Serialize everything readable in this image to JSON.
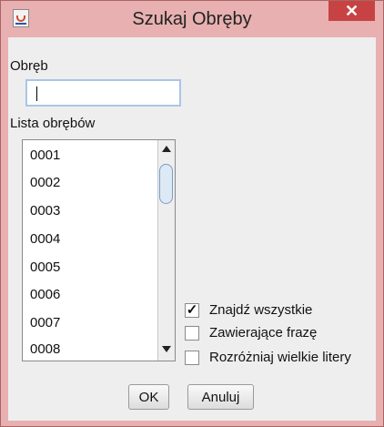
{
  "window": {
    "title": "Szukaj Obręby",
    "close_label": "✕"
  },
  "obreb": {
    "label": "Obręb",
    "value": ""
  },
  "list": {
    "label": "Lista obrębów",
    "items": [
      "0001",
      "0002",
      "0003",
      "0004",
      "0005",
      "0006",
      "0007",
      "0008"
    ]
  },
  "options": [
    {
      "label": "Znajdź wszystkie",
      "checked": true
    },
    {
      "label": "Zawierające frazę",
      "checked": false
    },
    {
      "label": "Rozróżniaj wielkie litery",
      "checked": false
    }
  ],
  "buttons": {
    "ok": "OK",
    "cancel": "Anuluj"
  },
  "colors": {
    "title_bar": "#e8b0b0",
    "close_button": "#c74343",
    "focus_border": "#a8c6e6"
  }
}
